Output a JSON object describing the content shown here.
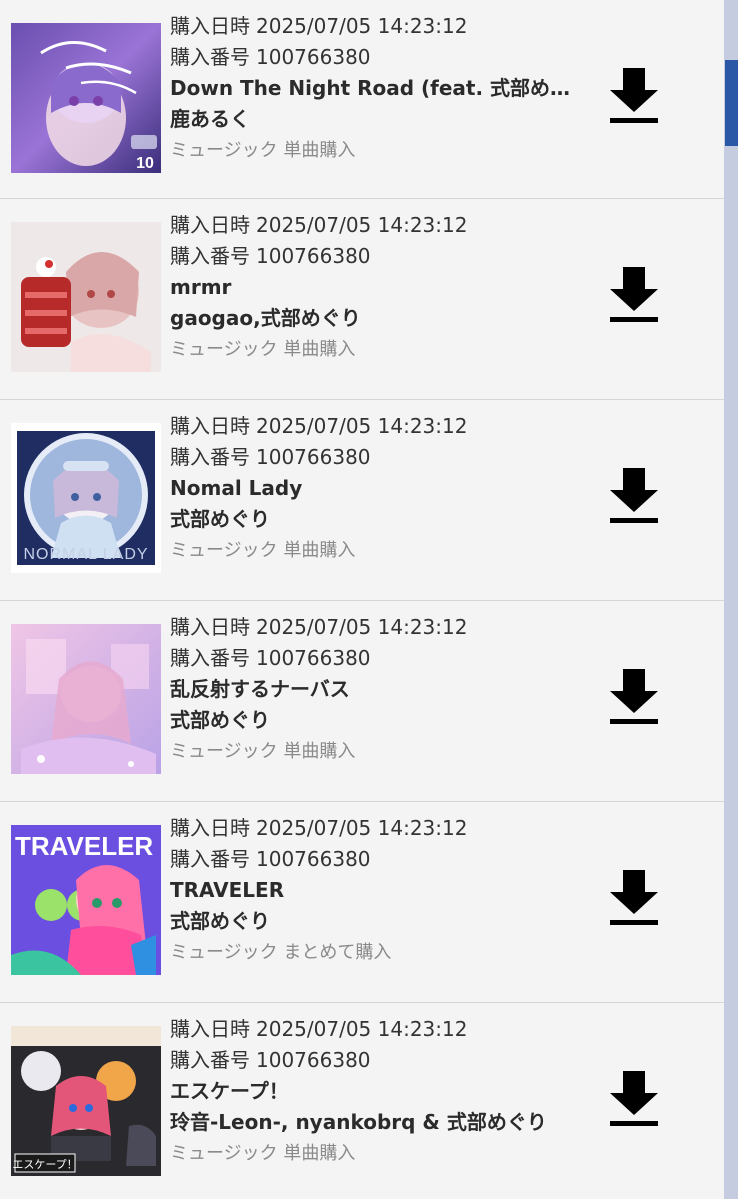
{
  "purchases": [
    {
      "date_label": "購入日時",
      "date": "2025/07/05 14:23:12",
      "number_label": "購入番号",
      "number": "100766380",
      "title": "Down The Night Road (feat. 式部めぐ…",
      "artist": "鹿あるく",
      "type": "ミュージック 単曲購入",
      "cover_text": "10"
    },
    {
      "date_label": "購入日時",
      "date": "2025/07/05 14:23:12",
      "number_label": "購入番号",
      "number": "100766380",
      "title": "mrmr",
      "artist": "gaogao,式部めぐり",
      "type": "ミュージック 単曲購入"
    },
    {
      "date_label": "購入日時",
      "date": "2025/07/05 14:23:12",
      "number_label": "購入番号",
      "number": "100766380",
      "title": "Nomal Lady",
      "artist": "式部めぐり",
      "type": "ミュージック 単曲購入",
      "cover_text": "NORMAL LADY"
    },
    {
      "date_label": "購入日時",
      "date": "2025/07/05 14:23:12",
      "number_label": "購入番号",
      "number": "100766380",
      "title": "乱反射するナーバス",
      "artist": "式部めぐり",
      "type": "ミュージック 単曲購入"
    },
    {
      "date_label": "購入日時",
      "date": "2025/07/05 14:23:12",
      "number_label": "購入番号",
      "number": "100766380",
      "title": "TRAVELER",
      "artist": "式部めぐり",
      "type": "ミュージック まとめて購入",
      "cover_text": "TRAVELER"
    },
    {
      "date_label": "購入日時",
      "date": "2025/07/05 14:23:12",
      "number_label": "購入番号",
      "number": "100766380",
      "title": "エスケープ！",
      "artist": "玲音-Leon-, nyankobrq & 式部めぐり",
      "type": "ミュージック 単曲購入",
      "cover_text": "エスケープ！"
    }
  ],
  "icons": {
    "download": "download-icon"
  },
  "colors": {
    "background": "#f4f4f4",
    "text_primary": "#2b2b2b",
    "text_secondary": "#8a8a8a",
    "scrollbar_track": "#c5cce0",
    "scrollbar_thumb": "#2b58a6"
  }
}
